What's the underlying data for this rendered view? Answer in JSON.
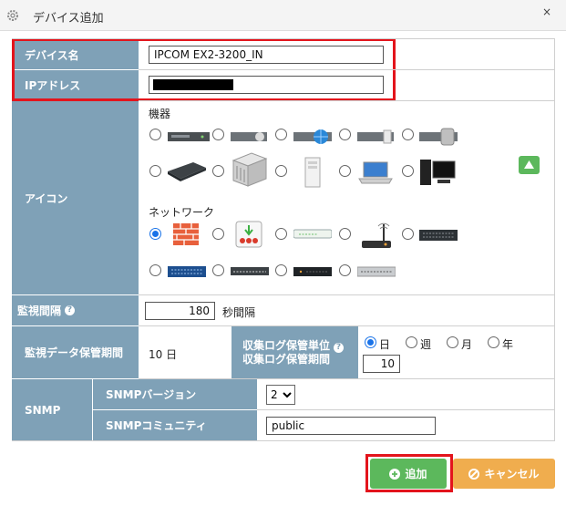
{
  "dialog": {
    "title": "デバイス追加",
    "close_label": "×"
  },
  "form": {
    "device_name": {
      "label": "デバイス名",
      "value": "IPCOM EX2-3200_IN"
    },
    "ip_address": {
      "label": "IPアドレス",
      "value": ""
    },
    "icon": {
      "label": "アイコン",
      "group_devices": "機器",
      "group_network": "ネットワーク",
      "device_icons": [
        "rack-1u-icon",
        "rack-2u-icon",
        "rack-globe-icon",
        "rack-disk-icon",
        "rack-storage-icon",
        "appliance-icon",
        "server-tower-icon",
        "white-tower-icon",
        "laptop-icon",
        "desktop-pc-icon"
      ],
      "network_icons": [
        "firewall-icon",
        "router-icon",
        "switch-white-icon",
        "wifi-router-icon",
        "switch-dark-icon",
        "switch-blue-icon",
        "switch-patch-icon",
        "switch-black-icon",
        "switch-gray-icon"
      ],
      "selected_group": "network",
      "selected_index": 0
    },
    "monitor_interval": {
      "label": "監視間隔",
      "value": "180",
      "unit": "秒間隔"
    },
    "retention": {
      "label": "監視データ保管期間",
      "value": "10 日",
      "log_unit_label": "収集ログ保管単位",
      "log_period_label": "収集ログ保管期間",
      "unit_options": [
        "日",
        "週",
        "月",
        "年"
      ],
      "selected_unit": "日",
      "log_period_value": "10"
    },
    "snmp": {
      "label": "SNMP",
      "version_label": "SNMPバージョン",
      "version_value": "2",
      "community_label": "SNMPコミュニティ",
      "community_value": "public"
    }
  },
  "buttons": {
    "add_label": "追加",
    "cancel_label": "キャンセル"
  },
  "colors": {
    "label_bg": "#7fa1b7",
    "highlight": "#e3141c",
    "add_button": "#5cb85c",
    "cancel_button": "#f0ad4e"
  }
}
